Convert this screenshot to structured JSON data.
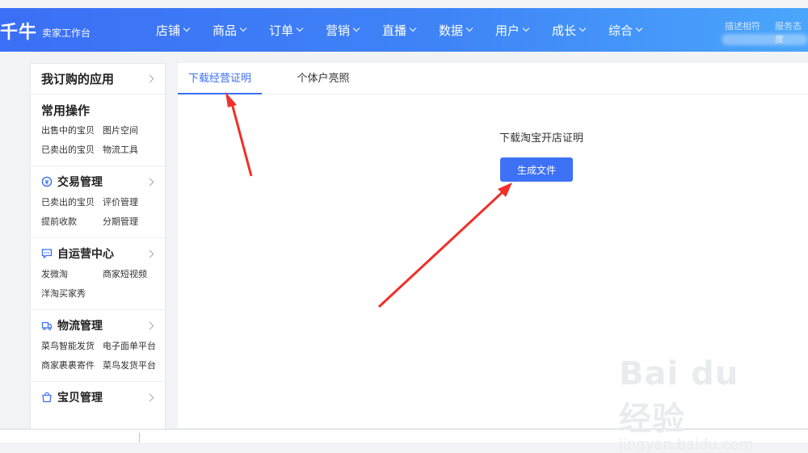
{
  "topbar": {
    "brand": "千牛",
    "brand_sub": "卖家工作台",
    "nav": [
      {
        "label": "店铺"
      },
      {
        "label": "商品"
      },
      {
        "label": "订单"
      },
      {
        "label": "营销"
      },
      {
        "label": "直播"
      },
      {
        "label": "数据"
      },
      {
        "label": "用户"
      },
      {
        "label": "成长"
      },
      {
        "label": "综合"
      }
    ],
    "right_links": [
      "描述相符",
      "服务态度"
    ]
  },
  "sidebar": {
    "header": "我订购的应用",
    "groups": [
      {
        "title": "常用操作",
        "icon": "none",
        "links": [
          "出售中的宝贝",
          "图片空间",
          "已卖出的宝贝",
          "物流工具"
        ]
      },
      {
        "title": "交易管理",
        "icon": "transaction-icon",
        "links": [
          "已卖出的宝贝",
          "评价管理",
          "提前收款",
          "分期管理"
        ]
      },
      {
        "title": "自运营中心",
        "icon": "chat-icon",
        "links": [
          "发微淘",
          "商家短视频",
          "洋淘买家秀"
        ]
      },
      {
        "title": "物流管理",
        "icon": "truck-icon",
        "links": [
          "菜鸟智能发货",
          "电子面单平台",
          "商家裹裹寄件",
          "菜鸟发货平台"
        ]
      },
      {
        "title": "宝贝管理",
        "icon": "bag-icon",
        "links": []
      }
    ]
  },
  "content": {
    "tabs": [
      {
        "label": "下载经营证明",
        "active": true
      },
      {
        "label": "个体户亮照",
        "active": false
      }
    ],
    "doc_title": "下载淘宝开店证明",
    "generate_button": "生成文件"
  },
  "watermark": {
    "main": "Bai du 经验",
    "sub": "jingyan.baidu.com"
  },
  "colors": {
    "primary": "#3b6ff5",
    "arrow": "#f0302a"
  }
}
